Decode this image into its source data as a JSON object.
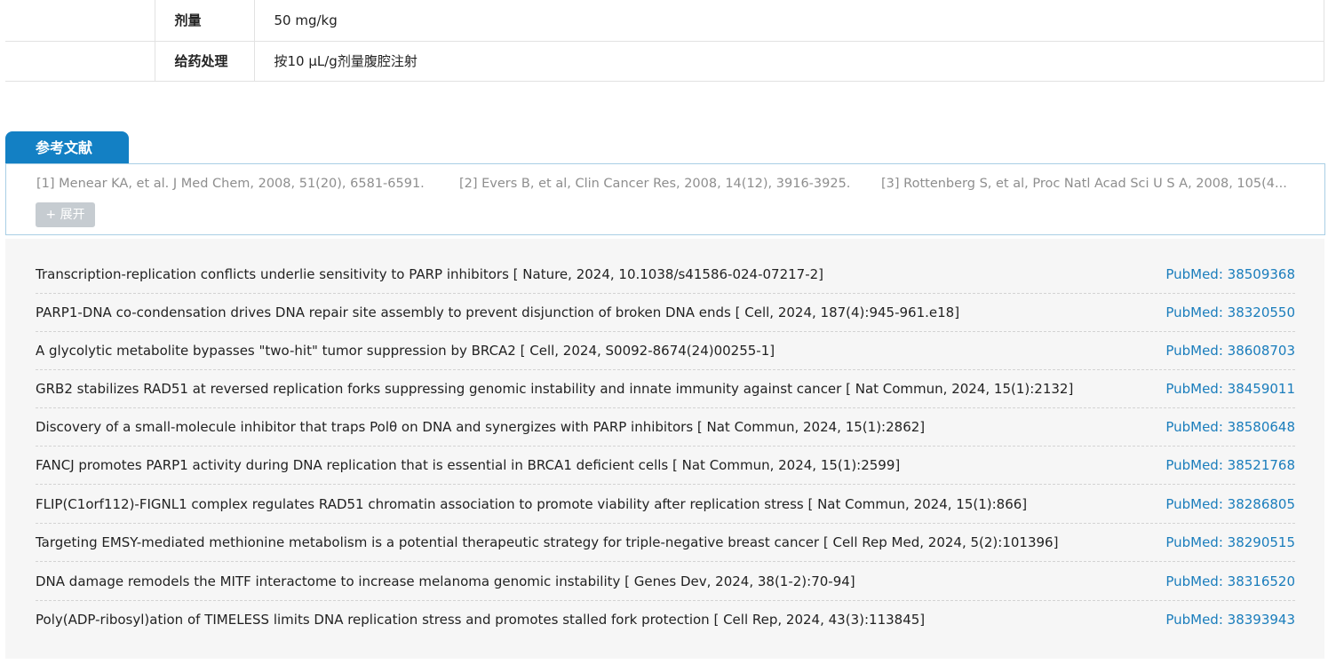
{
  "dosing_table": {
    "rows": [
      {
        "label": "剂量",
        "value": "50 mg/kg"
      },
      {
        "label": "给药处理",
        "value": "按10 μL/g剂量腹腔注射"
      }
    ]
  },
  "references": {
    "tab_label": "参考文献",
    "items": [
      "[1] Menear KA, et al. J Med Chem, 2008, 51(20), 6581-6591.",
      "[2] Evers B, et al, Clin Cancer Res, 2008, 14(12), 3916-3925.",
      "[3] Rottenberg S, et al, Proc Natl Acad Sci U S A, 2008, 105(4..."
    ],
    "expand_label": "+ 展开"
  },
  "publications": [
    {
      "title": "Transcription-replication conflicts underlie sensitivity to PARP inhibitors [ Nature, 2024, 10.1038/s41586-024-07217-2]",
      "pubmed": "PubMed: 38509368"
    },
    {
      "title": "PARP1-DNA co-condensation drives DNA repair site assembly to prevent disjunction of broken DNA ends [ Cell, 2024, 187(4):945-961.e18]",
      "pubmed": "PubMed: 38320550"
    },
    {
      "title": "A glycolytic metabolite bypasses \"two-hit\" tumor suppression by BRCA2 [ Cell, 2024, S0092-8674(24)00255-1]",
      "pubmed": "PubMed: 38608703"
    },
    {
      "title": "GRB2 stabilizes RAD51 at reversed replication forks suppressing genomic instability and innate immunity against cancer [ Nat Commun, 2024, 15(1):2132]",
      "pubmed": "PubMed: 38459011"
    },
    {
      "title": "Discovery of a small-molecule inhibitor that traps Polθ on DNA and synergizes with PARP inhibitors [ Nat Commun, 2024, 15(1):2862]",
      "pubmed": "PubMed: 38580648"
    },
    {
      "title": "FANCJ promotes PARP1 activity during DNA replication that is essential in BRCA1 deficient cells [ Nat Commun, 2024, 15(1):2599]",
      "pubmed": "PubMed: 38521768"
    },
    {
      "title": "FLIP(C1orf112)-FIGNL1 complex regulates RAD51 chromatin association to promote viability after replication stress [ Nat Commun, 2024, 15(1):866]",
      "pubmed": "PubMed: 38286805"
    },
    {
      "title": "Targeting EMSY-mediated methionine metabolism is a potential therapeutic strategy for triple-negative breast cancer [ Cell Rep Med, 2024, 5(2):101396]",
      "pubmed": "PubMed: 38290515"
    },
    {
      "title": "DNA damage remodels the MITF interactome to increase melanoma genomic instability [ Genes Dev, 2024, 38(1-2):70-94]",
      "pubmed": "PubMed: 38316520"
    },
    {
      "title": "Poly(ADP-ribosyl)ation of TIMELESS limits DNA replication stress and promotes stalled fork protection [ Cell Rep, 2024, 43(3):113845]",
      "pubmed": "PubMed: 38393943"
    }
  ]
}
